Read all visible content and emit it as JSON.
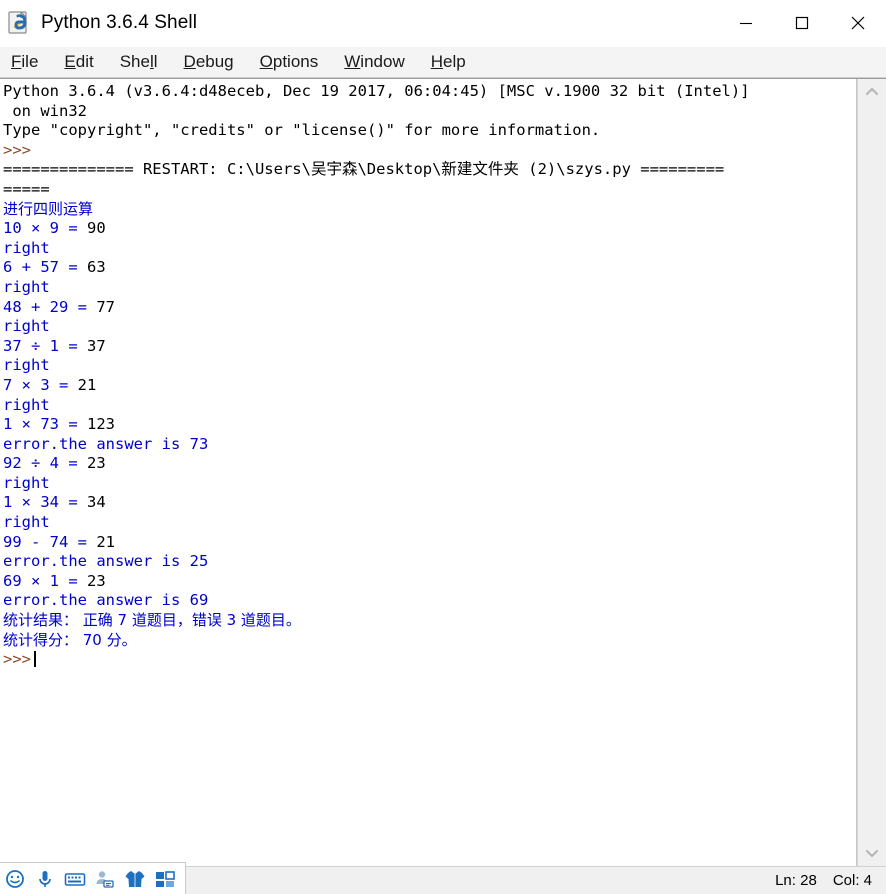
{
  "window": {
    "title": "Python 3.6.4 Shell",
    "icon": "python-idle-icon",
    "controls": {
      "minimize": "minimize-button",
      "maximize": "maximize-button",
      "close": "close-button"
    }
  },
  "menubar": {
    "items": [
      {
        "label": "File",
        "mnemonic": "F",
        "before": "",
        "after": "ile"
      },
      {
        "label": "Edit",
        "mnemonic": "E",
        "before": "",
        "after": "dit"
      },
      {
        "label": "Shell",
        "mnemonic": "l",
        "before": "She",
        "after": "l"
      },
      {
        "label": "Debug",
        "mnemonic": "D",
        "before": "",
        "after": "ebug"
      },
      {
        "label": "Options",
        "mnemonic": "O",
        "before": "",
        "after": "ptions"
      },
      {
        "label": "Window",
        "mnemonic": "W",
        "before": "",
        "after": "indow"
      },
      {
        "label": "Help",
        "mnemonic": "H",
        "before": "",
        "after": "elp"
      }
    ]
  },
  "shell": {
    "banner_line1": "Python 3.6.4 (v3.6.4:d48eceb, Dec 19 2017, 06:04:45) [MSC v.1900 32 bit (Intel)]",
    "banner_line2": " on win32",
    "banner_line3": "Type \"copyright\", \"credits\" or \"license()\" for more information.",
    "prompt1": ">>>",
    "restart_line": "============== RESTART: C:\\Users\\吴宇森\\Desktop\\新建文件夹 (2)\\szys.py =========",
    "restart_line_wrap": "=====",
    "header": "进行四则运算",
    "quiz": [
      {
        "question": "10 × 9 = ",
        "answer": "90",
        "result": "right"
      },
      {
        "question": "6 + 57 = ",
        "answer": "63",
        "result": "right"
      },
      {
        "question": "48 + 29 = ",
        "answer": "77",
        "result": "right"
      },
      {
        "question": "37 ÷ 1 = ",
        "answer": "37",
        "result": "right"
      },
      {
        "question": "7 × 3 = ",
        "answer": "21",
        "result": "right"
      },
      {
        "question": "1 × 73 = ",
        "answer": "123",
        "result": "error.the answer is 73"
      },
      {
        "question": "92 ÷ 4 = ",
        "answer": "23",
        "result": "right"
      },
      {
        "question": "1 × 34 = ",
        "answer": "34",
        "result": "right"
      },
      {
        "question": "99 - 74 = ",
        "answer": "21",
        "result": "error.the answer is 25"
      },
      {
        "question": "69 × 1 = ",
        "answer": "23",
        "result": "error.the answer is 69"
      }
    ],
    "summary_result": "统计结果： 正确 7 道题目，错误 3 道题目。",
    "summary_score": "统计得分： 70 分。",
    "prompt2": ">>>"
  },
  "statusbar": {
    "line": "Ln: 28",
    "col": "Col: 4"
  },
  "scrollbar": {
    "up": "scroll-up-arrow",
    "down": "scroll-down-arrow"
  },
  "taskbar": {
    "icons": [
      "smiley-icon",
      "microphone-icon",
      "keyboard-icon",
      "person-card-icon",
      "shirt-icon",
      "app-grid-icon"
    ]
  },
  "colors": {
    "output_blue": "#0000cc",
    "prompt_brown": "#8b4a2b",
    "stdin_black": "#000000",
    "taskbar_blue": "#1d6fc0"
  }
}
